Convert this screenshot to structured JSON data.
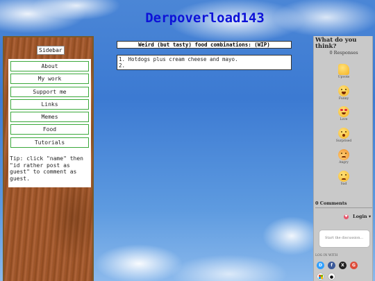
{
  "site": {
    "title": "Derpoverload143"
  },
  "sidebar": {
    "title": "Sidebar",
    "items": [
      {
        "label": "About"
      },
      {
        "label": "My work"
      },
      {
        "label": "Support me"
      },
      {
        "label": "Links"
      },
      {
        "label": "Memes"
      },
      {
        "label": "Food"
      },
      {
        "label": "Tutorials"
      }
    ],
    "tip": "Tip: click \"name\" then \"id rather post as guest\" to comment as guest."
  },
  "post": {
    "title": "Weird (but tasty) food combinations: (WIP)",
    "lines": [
      "1. Hotdogs plus cream cheese and mayo.",
      "2."
    ]
  },
  "comments": {
    "heading": "What do you think?",
    "responses": "0 Responses",
    "reactions": [
      {
        "label": "Upvote",
        "icon": "thumbs-up-icon"
      },
      {
        "label": "Funny",
        "icon": "laughing-face-icon"
      },
      {
        "label": "Love",
        "icon": "heart-eyes-icon"
      },
      {
        "label": "Surprised",
        "icon": "surprised-face-icon"
      },
      {
        "label": "Angry",
        "icon": "angry-face-icon"
      },
      {
        "label": "Sad",
        "icon": "sad-face-icon"
      }
    ],
    "count_label": "0 Comments",
    "login_label": "Login ▾",
    "discussion_placeholder": "Start the discussion...",
    "login_with": "LOG IN WITH",
    "providers": [
      {
        "name": "Disqus",
        "glyph": "D",
        "color": "#2e9fff"
      },
      {
        "name": "Facebook",
        "glyph": "f",
        "color": "#3b5998"
      },
      {
        "name": "X",
        "glyph": "X",
        "color": "#222222"
      },
      {
        "name": "Google",
        "glyph": "G",
        "color": "#dd4b39"
      },
      {
        "name": "Microsoft",
        "glyph": "■",
        "color": "#ffffff"
      },
      {
        "name": "Apple",
        "glyph": "",
        "color": "#ffffff"
      }
    ]
  }
}
